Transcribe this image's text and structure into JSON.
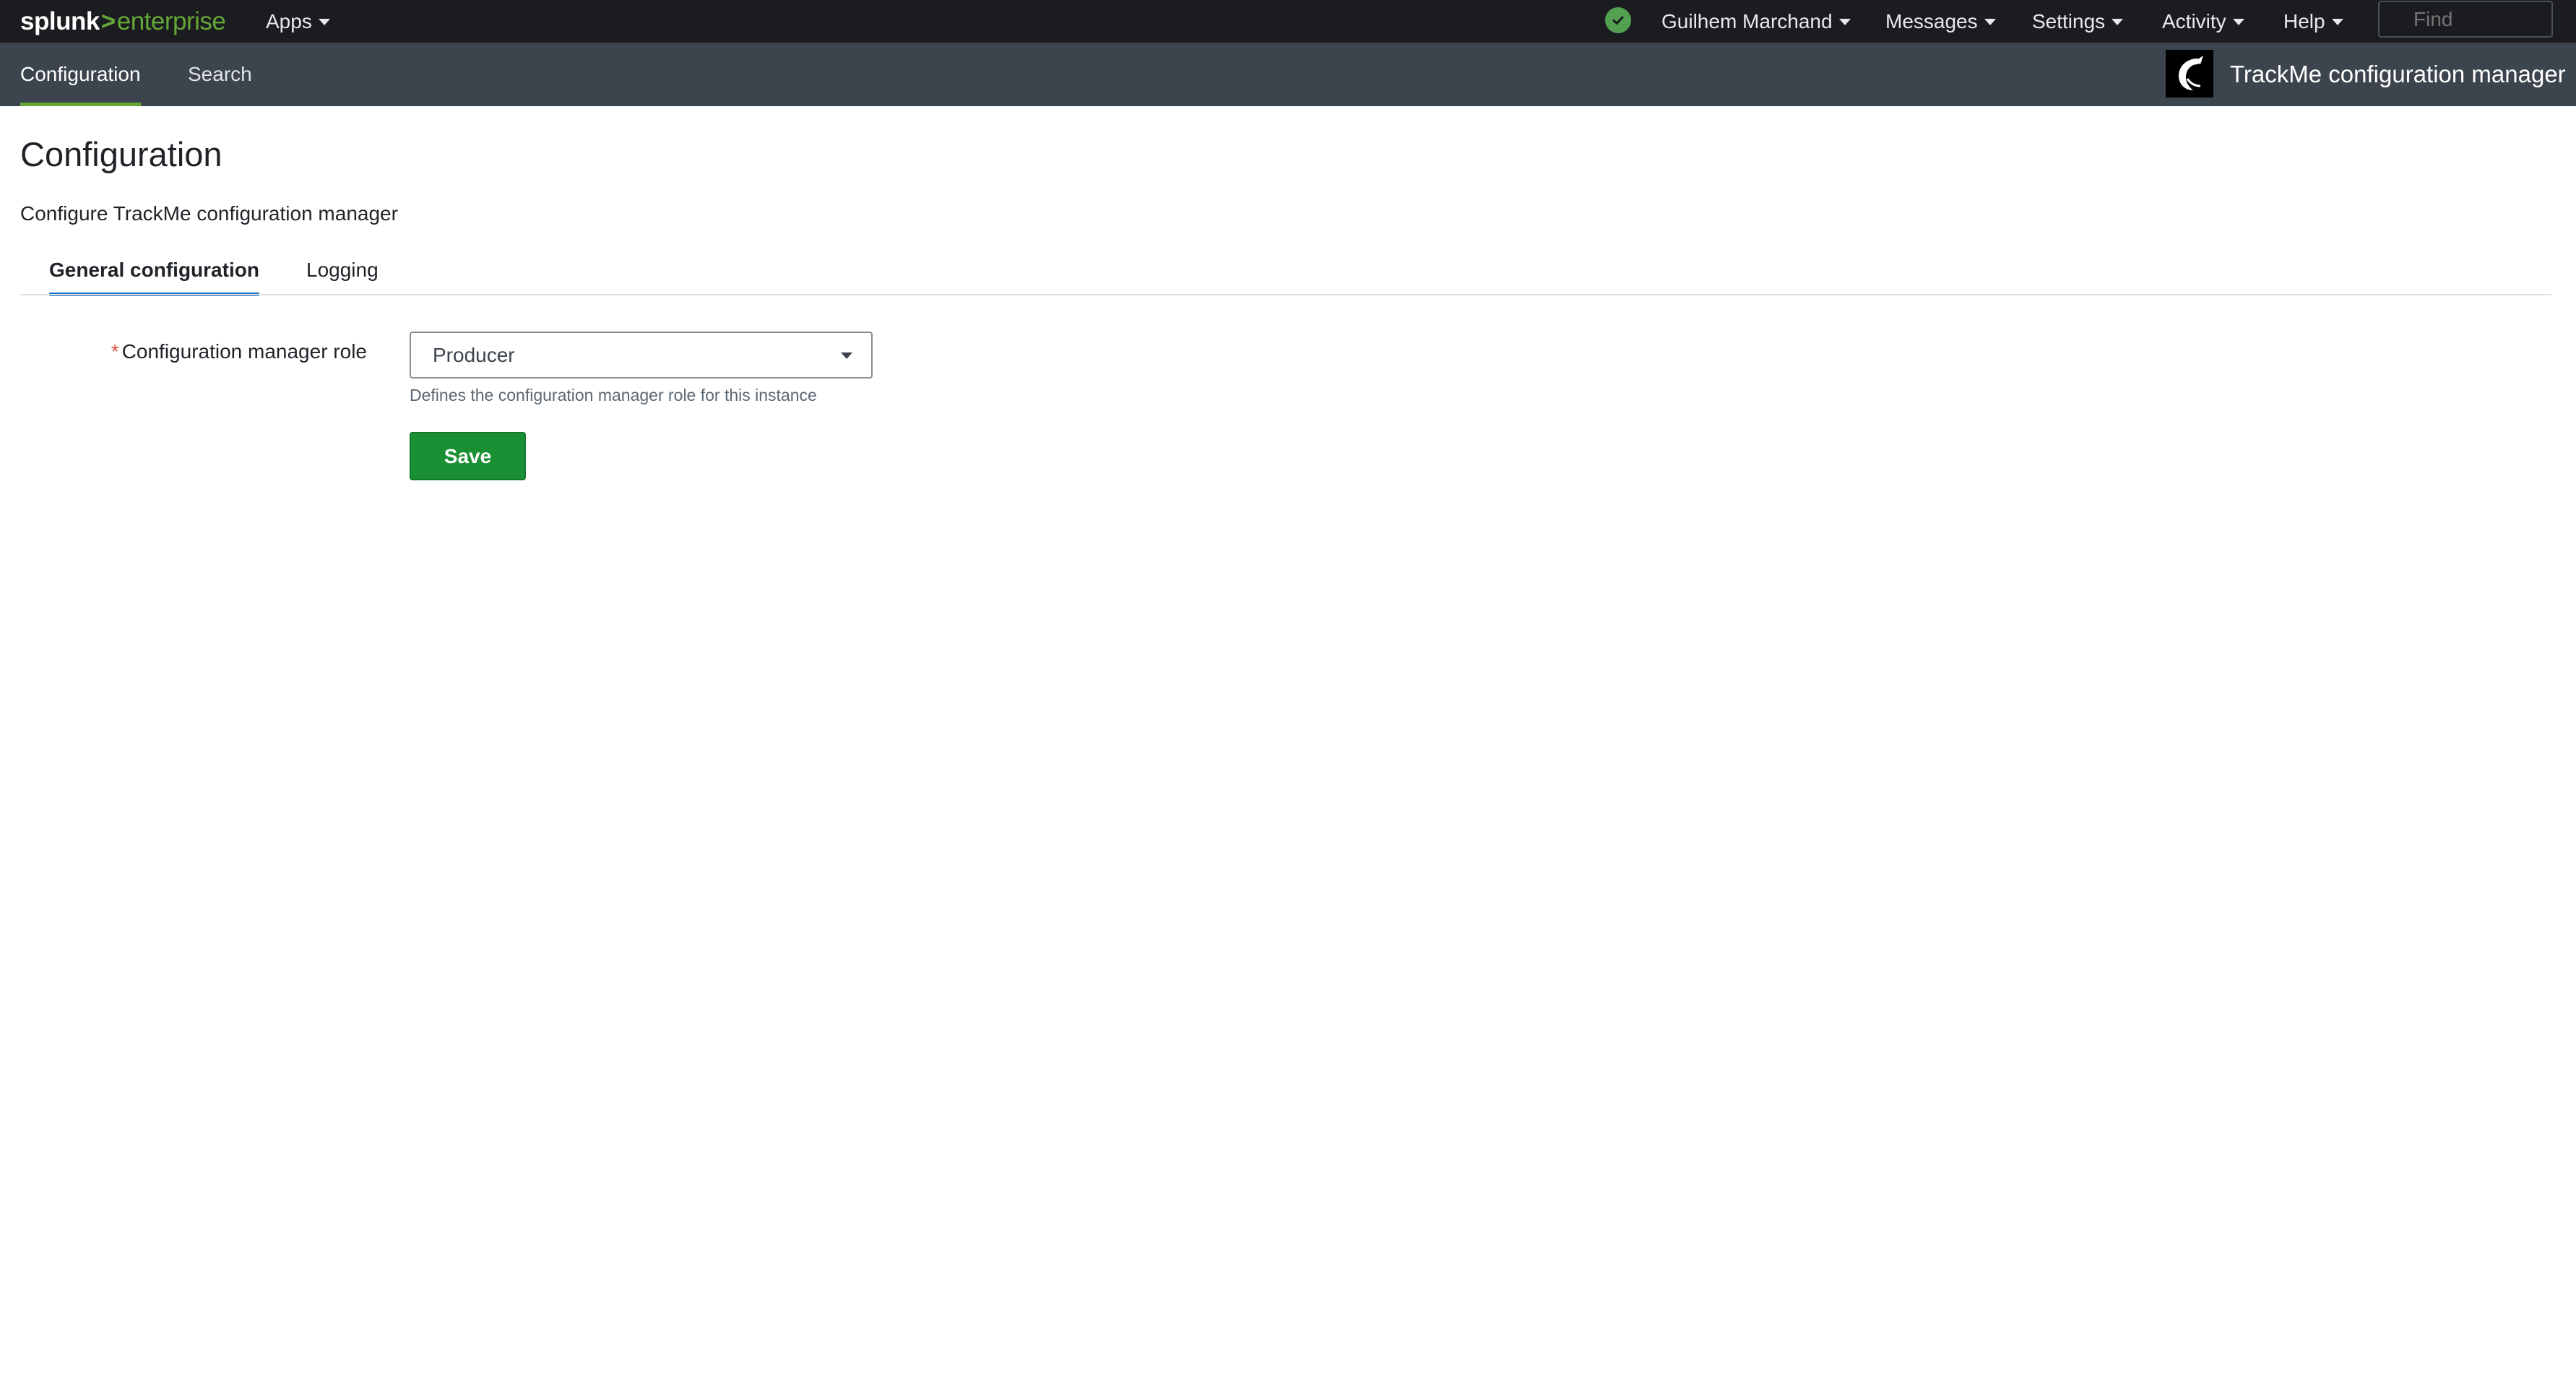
{
  "brand": {
    "part1": "splunk",
    "separator": ">",
    "part2": "enterprise"
  },
  "top_nav": {
    "apps": "Apps",
    "user": "Guilhem Marchand",
    "messages": "Messages",
    "settings": "Settings",
    "activity": "Activity",
    "help": "Help",
    "find_placeholder": "Find",
    "status_icon": "check-circle-icon",
    "status_color": "#53a051"
  },
  "app_bar": {
    "nav": [
      {
        "label": "Configuration",
        "active": true
      },
      {
        "label": "Search",
        "active": false
      }
    ],
    "app_title": "TrackMe configuration manager",
    "accent_color": "#65a637"
  },
  "page": {
    "title": "Configuration",
    "description": "Configure TrackMe configuration manager",
    "tabs": [
      {
        "label": "General configuration",
        "active": true
      },
      {
        "label": "Logging",
        "active": false
      }
    ],
    "form": {
      "role_label": "Configuration manager role",
      "required_marker": "*",
      "role_value": "Producer",
      "role_help": "Defines the configuration manager role for this instance",
      "save_label": "Save",
      "save_color": "#1a9035"
    }
  }
}
